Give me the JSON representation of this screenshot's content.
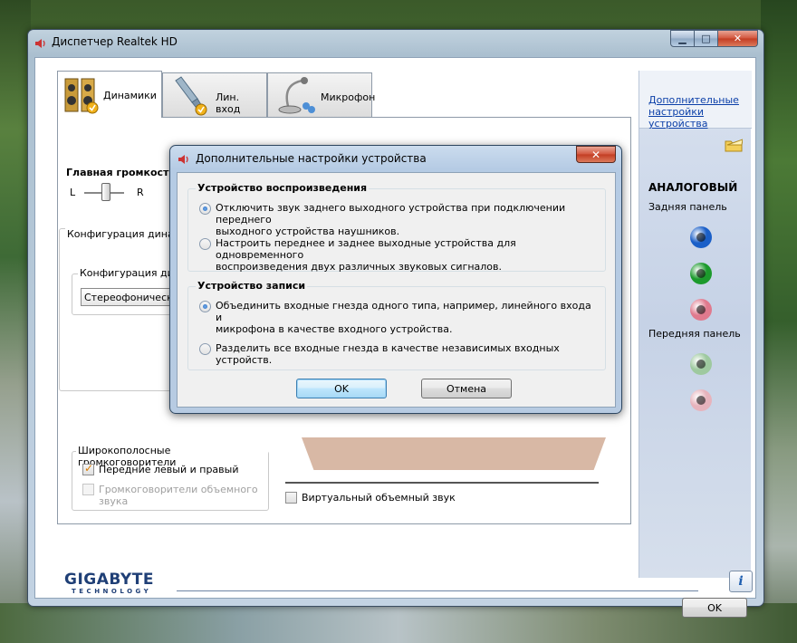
{
  "window": {
    "title": "Диспетчер Realtek HD",
    "caption": {
      "minimize": "▁",
      "maximize": "□",
      "close": "✕"
    }
  },
  "tabs": [
    {
      "label": "Динамики",
      "active": true,
      "icon": "speakers-icon"
    },
    {
      "label": "Лин. вход",
      "active": false,
      "icon": "line-in-icon"
    },
    {
      "label": "Микрофон",
      "active": false,
      "icon": "microphone-icon"
    }
  ],
  "main": {
    "volume_title": "Главная громкость",
    "left_label": "L",
    "right_label": "R",
    "config_group": "Конфигурация динами",
    "config_inner": "Конфигурация дина",
    "config_select": "Стереофонический",
    "wideband_group": "Широкополосные громкоговорители",
    "front_lr": "Передние левый и правый",
    "surround_line1": "Громкоговорители объемного",
    "surround_line2": "звука",
    "virtual_surround": "Виртуальный объемный звук"
  },
  "side": {
    "link_line1": "Дополнительные",
    "link_line2": "настройки",
    "link_line3": "устройства",
    "analog": "АНАЛОГОВЫЙ",
    "rear_panel": "Задняя панель",
    "front_panel": "Передняя панель",
    "rear_jacks": [
      "#1a5fc8",
      "#1c9a2c",
      "#e07a8e"
    ],
    "front_jacks": [
      "#9ec99f",
      "#e7b3bc"
    ]
  },
  "footer": {
    "brand": "GIGABYTE",
    "brand_sub": "TECHNOLOGY",
    "ok": "OK",
    "info": "i"
  },
  "dialog": {
    "title": "Дополнительные настройки устройства",
    "close": "✕",
    "playback_group": "Устройство воспроизведения",
    "playback_opt1_line1": "Отключить звук заднего выходного устройства при подключении переднего",
    "playback_opt1_line2": "выходного устройства наушников.",
    "playback_opt2_line1": "Настроить переднее и заднее выходные устройства для одновременного",
    "playback_opt2_line2": "воспроизведения двух различных звуковых сигналов.",
    "record_group": "Устройство записи",
    "record_opt1_line1": "Объединить входные гнезда одного типа, например, линейного входа и",
    "record_opt1_line2": "микрофона в качестве входного устройства.",
    "record_opt2": "Разделить все входные гнезда в качестве независимых входных устройств.",
    "ok": "OK",
    "cancel": "Отмена"
  }
}
